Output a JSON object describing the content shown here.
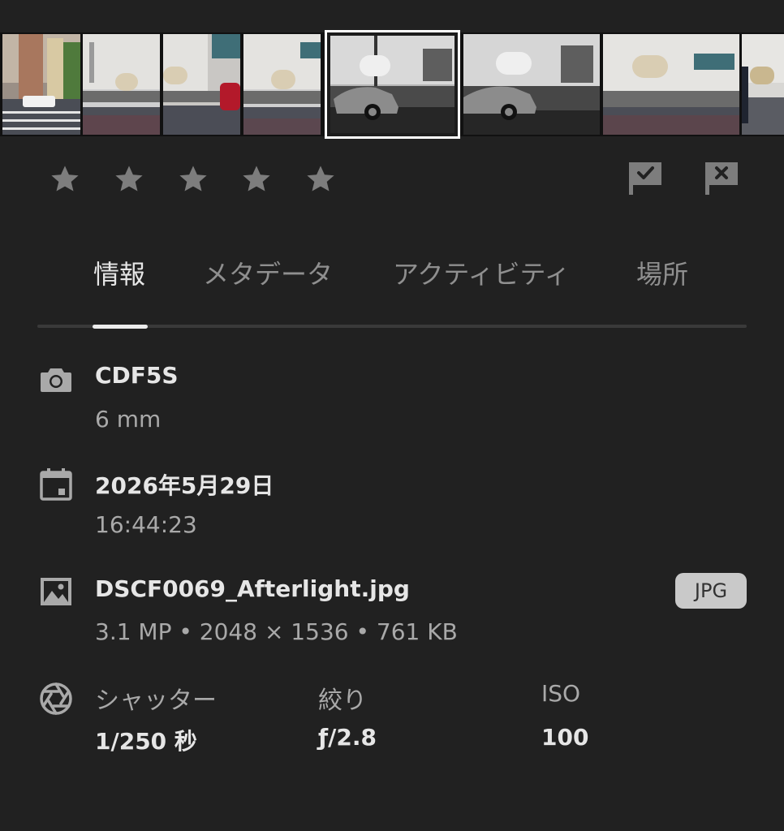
{
  "filmstrip": {
    "thumbnails": [
      {
        "label": "street-color"
      },
      {
        "label": "building-color"
      },
      {
        "label": "building-red-car"
      },
      {
        "label": "building-color"
      },
      {
        "label": "car-bw",
        "selected": true
      },
      {
        "label": "car-bw-2"
      },
      {
        "label": "building-color"
      },
      {
        "label": "building-dark-car"
      },
      {
        "label": "building-edge"
      }
    ]
  },
  "rating": {
    "stars": 5,
    "value": 0,
    "icons": [
      "star-icon",
      "pick-flag-icon",
      "reject-flag-icon"
    ]
  },
  "tabs": [
    {
      "label": "情報",
      "active": true
    },
    {
      "label": "メタデータ",
      "active": false
    },
    {
      "label": "アクティビティ",
      "active": false
    },
    {
      "label": "場所",
      "active": false
    }
  ],
  "camera": {
    "icon": "camera-icon",
    "model": "CDF5S",
    "focal_length": "6 mm"
  },
  "capture_date": {
    "icon": "calendar-icon",
    "date": "2026年5月29日",
    "time": "16:44:23"
  },
  "file": {
    "icon": "image-icon",
    "name": "DSCF0069_Afterlight.jpg",
    "details": "3.1 MP • 2048 × 1536 • 761 KB",
    "format_badge": "JPG"
  },
  "exposure": {
    "icon": "aperture-icon",
    "shutter_label": "シャッター",
    "shutter_value": "1/250 秒",
    "aperture_label": "絞り",
    "aperture_value": "ƒ/2.8",
    "iso_label": "ISO",
    "iso_value": "100"
  },
  "colors": {
    "background": "#212121",
    "selected_border": "#ffffff",
    "muted_icon": "#7d7d7d"
  }
}
